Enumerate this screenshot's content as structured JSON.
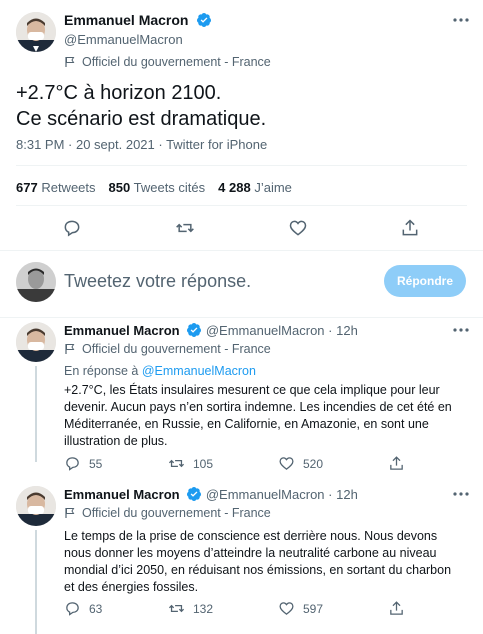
{
  "main_tweet": {
    "author_name": "Emmanuel Macron",
    "author_handle": "@EmmanuelMacron",
    "label": "Officiel du gouvernement - France",
    "text": "+2.7°C à horizon 2100.\nCe scénario est dramatique.",
    "meta": "8:31 PM · 20 sept. 2021 · Twitter for iPhone",
    "stats": {
      "retweets_count": "677",
      "retweets_label": "Retweets",
      "quotes_count": "850",
      "quotes_label": "Tweets cités",
      "likes_count": "4 288",
      "likes_label": "J’aime"
    }
  },
  "composer": {
    "placeholder": "Tweetez votre réponse.",
    "reply_button": "Répondre"
  },
  "thread": [
    {
      "author_name": "Emmanuel Macron",
      "author_handle": "@EmmanuelMacron",
      "time": "12h",
      "label": "Officiel du gouvernement - France",
      "reply_prefix": "En réponse à",
      "reply_handle": "@EmmanuelMacron",
      "text": "+2.7°C, les États insulaires mesurent ce que cela implique pour leur devenir. Aucun pays n’en sortira indemne. Les incendies de cet été en Méditerranée, en Russie, en Californie, en Amazonie, en sont une illustration de plus.",
      "replies": "55",
      "retweets": "105",
      "likes": "520"
    },
    {
      "author_name": "Emmanuel Macron",
      "author_handle": "@EmmanuelMacron",
      "time": "12h",
      "label": "Officiel du gouvernement - France",
      "text": "Le temps de la prise de conscience est derrière nous. Nous devons nous donner les moyens d’atteindre la neutralité carbone au niveau mondial d’ici 2050, en réduisant nos émissions, en sortant du charbon et des énergies fossiles.",
      "replies": "63",
      "retweets": "132",
      "likes": "597"
    }
  ],
  "colors": {
    "accent": "#1d9bf0",
    "muted": "#536471",
    "button_disabled": "#8ecdf8",
    "divider": "#eff3f4"
  },
  "icons": [
    "verified-badge-icon",
    "more-icon",
    "government-flag-icon",
    "reply-icon",
    "retweet-icon",
    "like-icon",
    "share-icon"
  ]
}
